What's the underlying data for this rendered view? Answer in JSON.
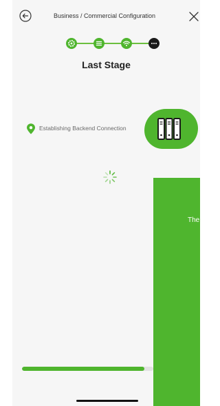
{
  "header": {
    "title": "Business / Commercial Configuration",
    "back_icon": "back-circle-arrow-icon",
    "close_icon": "close-x-icon"
  },
  "stepper": {
    "steps": [
      {
        "icon": "gear-icon",
        "state": "done"
      },
      {
        "icon": "list-icon",
        "state": "done"
      },
      {
        "icon": "wifi-icon",
        "state": "done"
      },
      {
        "icon": "more-dots-icon",
        "state": "active"
      }
    ],
    "accent_color": "#4fb52e"
  },
  "stage": {
    "title": "Last Stage"
  },
  "status": {
    "text": "Establishing Backend Connection",
    "icon": "location-pin-icon"
  },
  "server": {
    "icon": "server-rack-icon"
  },
  "loading": {
    "icon": "spinner-icon"
  },
  "panel": {
    "text": "The"
  },
  "progress": {
    "value": 0.93
  }
}
